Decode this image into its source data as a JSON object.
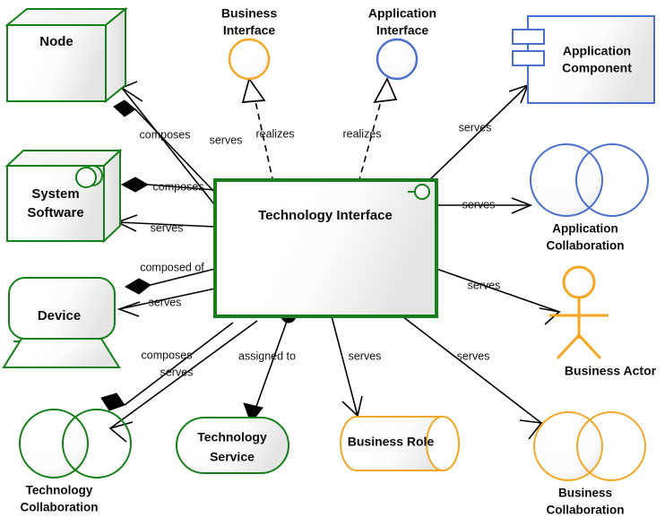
{
  "diagram": {
    "title": "Technology Interface relationships (ArchiMate)",
    "colors": {
      "technology_green": "#15801a",
      "business_orange": "#f5a623",
      "application_blue": "#4a6fd1",
      "line_black": "#000000",
      "fill_white": "#ffffff",
      "fill_gradient_grey": "#e9e9e9"
    },
    "elements": [
      {
        "id": "node",
        "label": "Node",
        "layer": "technology",
        "shape": "node-3d-box",
        "color": "#15801a"
      },
      {
        "id": "business-interface",
        "label_line1": "Business",
        "label_line2": "Interface",
        "layer": "business",
        "shape": "interface-circle",
        "color": "#f5a623"
      },
      {
        "id": "application-interface",
        "label_line1": "Application",
        "label_line2": "Interface",
        "layer": "application",
        "shape": "interface-circle",
        "color": "#4a6fd1"
      },
      {
        "id": "application-component",
        "label_line1": "Application",
        "label_line2": "Component",
        "layer": "application",
        "shape": "component",
        "color": "#4a6fd1"
      },
      {
        "id": "system-software",
        "label_line1": "System",
        "label_line2": "Software",
        "layer": "technology",
        "shape": "node-3d-box-with-circles",
        "color": "#15801a"
      },
      {
        "id": "technology-interface",
        "label": "Technology Interface",
        "layer": "technology",
        "shape": "rectangle-with-lollipop",
        "color": "#15801a"
      },
      {
        "id": "application-collaboration",
        "label_line1": "Application",
        "label_line2": "Collaboration",
        "layer": "application",
        "shape": "two-overlapping-circles",
        "color": "#4a6fd1"
      },
      {
        "id": "device",
        "label": "Device",
        "layer": "technology",
        "shape": "device-monitor",
        "color": "#15801a"
      },
      {
        "id": "business-actor",
        "label": "Business Actor",
        "layer": "business",
        "shape": "stick-figure",
        "color": "#f5a623"
      },
      {
        "id": "technology-collaboration",
        "label_line1": "Technology",
        "label_line2": "Collaboration",
        "layer": "technology",
        "shape": "two-overlapping-circles",
        "color": "#15801a"
      },
      {
        "id": "technology-service",
        "label_line1": "Technology",
        "label_line2": "Service",
        "layer": "technology",
        "shape": "rounded-pill",
        "color": "#15801a"
      },
      {
        "id": "business-role",
        "label": "Business Role",
        "layer": "business",
        "shape": "cylinder",
        "color": "#f5a623"
      },
      {
        "id": "business-collaboration",
        "label_line1": "Business",
        "label_line2": "Collaboration",
        "layer": "business",
        "shape": "two-overlapping-circles",
        "color": "#f5a623"
      }
    ],
    "relationships": [
      {
        "id": "rel-node-composes",
        "label": "composes",
        "from": "technology-interface",
        "to": "node",
        "type": "composition"
      },
      {
        "id": "rel-node-serves",
        "label": "serves",
        "from": "technology-interface",
        "to": "node",
        "type": "serving"
      },
      {
        "id": "rel-business-interface-realizes",
        "label": "realizes",
        "from": "technology-interface",
        "to": "business-interface",
        "type": "realization"
      },
      {
        "id": "rel-application-interface-realizes",
        "label": "realizes",
        "from": "technology-interface",
        "to": "application-interface",
        "type": "realization"
      },
      {
        "id": "rel-application-component-serves",
        "label": "serves",
        "from": "technology-interface",
        "to": "application-component",
        "type": "serving"
      },
      {
        "id": "rel-system-software-composes",
        "label": "composes",
        "from": "technology-interface",
        "to": "system-software",
        "type": "composition"
      },
      {
        "id": "rel-system-software-serves",
        "label": "serves",
        "from": "technology-interface",
        "to": "system-software",
        "type": "serving"
      },
      {
        "id": "rel-application-collaboration-serves",
        "label": "serves",
        "from": "technology-interface",
        "to": "application-collaboration",
        "type": "serving"
      },
      {
        "id": "rel-device-composed-of",
        "label": "composed of",
        "from": "technology-interface",
        "to": "device",
        "type": "composition"
      },
      {
        "id": "rel-device-serves",
        "label": "serves",
        "from": "technology-interface",
        "to": "device",
        "type": "serving"
      },
      {
        "id": "rel-business-actor-serves",
        "label": "serves",
        "from": "technology-interface",
        "to": "business-actor",
        "type": "serving"
      },
      {
        "id": "rel-technology-collaboration-composes",
        "label": "composes",
        "from": "technology-interface",
        "to": "technology-collaboration",
        "type": "composition"
      },
      {
        "id": "rel-technology-collaboration-serves",
        "label": "serves",
        "from": "technology-interface",
        "to": "technology-collaboration",
        "type": "serving"
      },
      {
        "id": "rel-technology-service-assigned-to",
        "label": "assigned to",
        "from": "technology-interface",
        "to": "technology-service",
        "type": "assignment"
      },
      {
        "id": "rel-business-role-serves",
        "label": "serves",
        "from": "technology-interface",
        "to": "business-role",
        "type": "serving"
      },
      {
        "id": "rel-business-collaboration-serves",
        "label": "serves",
        "from": "technology-interface",
        "to": "business-collaboration",
        "type": "serving"
      }
    ]
  }
}
